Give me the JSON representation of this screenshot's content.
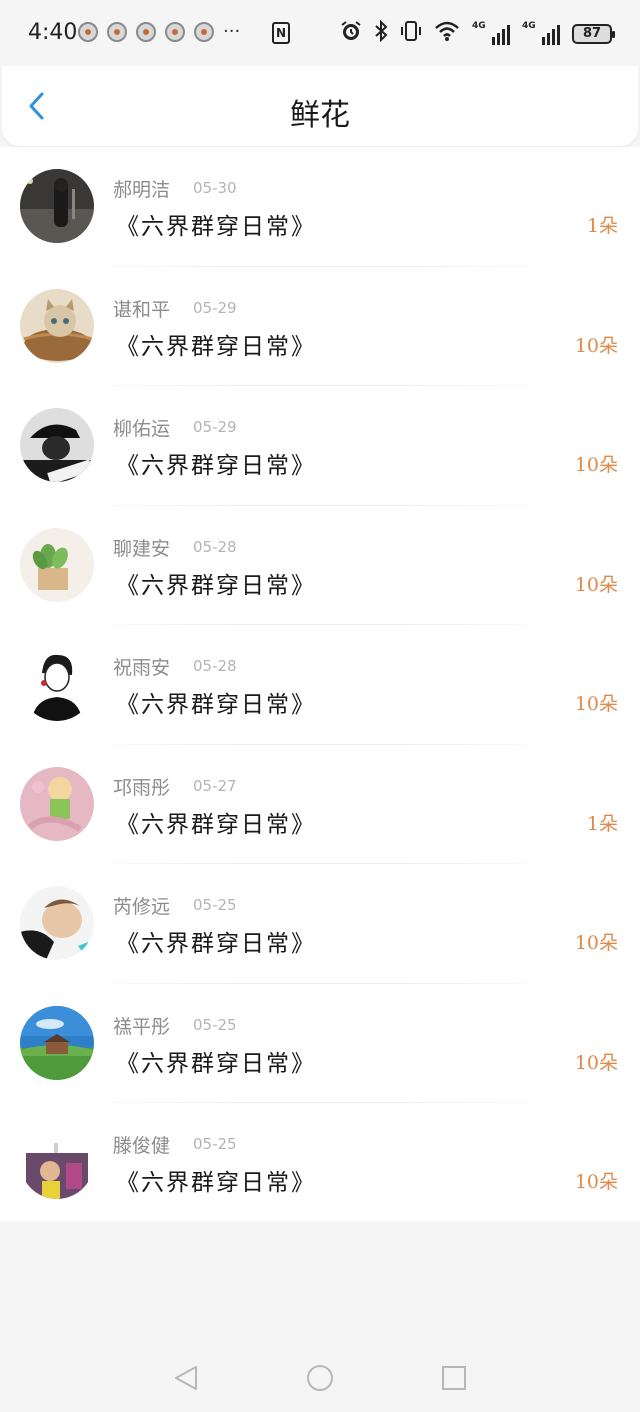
{
  "status_bar": {
    "time": "4:40",
    "more_indicator": "···",
    "nfc_label": "N",
    "battery": "87",
    "network_tag": "4G",
    "icons": [
      "alarm-icon",
      "bluetooth-icon",
      "vibrate-icon",
      "wifi-icon",
      "signal-4g-icon",
      "signal-4g-icon",
      "battery-icon"
    ]
  },
  "header": {
    "title": "鲜花",
    "back_icon": "chevron-left-icon"
  },
  "colors": {
    "accent_blue": "#2f8fe0",
    "count_orange": "#e0894a",
    "name_gray": "#8c8c8c",
    "date_gray": "#b4b4b4"
  },
  "items": [
    {
      "name": "郝明洁",
      "date": "05-30",
      "book": "《六界群穿日常》",
      "count": "1朵",
      "avatar": "night-street"
    },
    {
      "name": "谌和平",
      "date": "05-29",
      "book": "《六界群穿日常》",
      "count": "10朵",
      "avatar": "kitten-basket"
    },
    {
      "name": "柳佑运",
      "date": "05-29",
      "book": "《六界群穿日常》",
      "count": "10朵",
      "avatar": "hat-man-bw"
    },
    {
      "name": "聊建安",
      "date": "05-28",
      "book": "《六界群穿日常》",
      "count": "10朵",
      "avatar": "potted-plant"
    },
    {
      "name": "祝雨安",
      "date": "05-28",
      "book": "《六界群穿日常》",
      "count": "10朵",
      "avatar": "cartoon-boy"
    },
    {
      "name": "邛雨彤",
      "date": "05-27",
      "book": "《六界群穿日常》",
      "count": "1朵",
      "avatar": "anime-girl"
    },
    {
      "name": "芮修远",
      "date": "05-25",
      "book": "《六界群穿日常》",
      "count": "10朵",
      "avatar": "child-face"
    },
    {
      "name": "禚平彤",
      "date": "05-25",
      "book": "《六界群穿日常》",
      "count": "10朵",
      "avatar": "landscape"
    },
    {
      "name": "滕俊健",
      "date": "05-25",
      "book": "《六界群穿日常》",
      "count": "10朵",
      "avatar": "kid-photo"
    }
  ],
  "nav": {
    "back": "triangle-back-icon",
    "home": "circle-home-icon",
    "recents": "square-recents-icon"
  }
}
